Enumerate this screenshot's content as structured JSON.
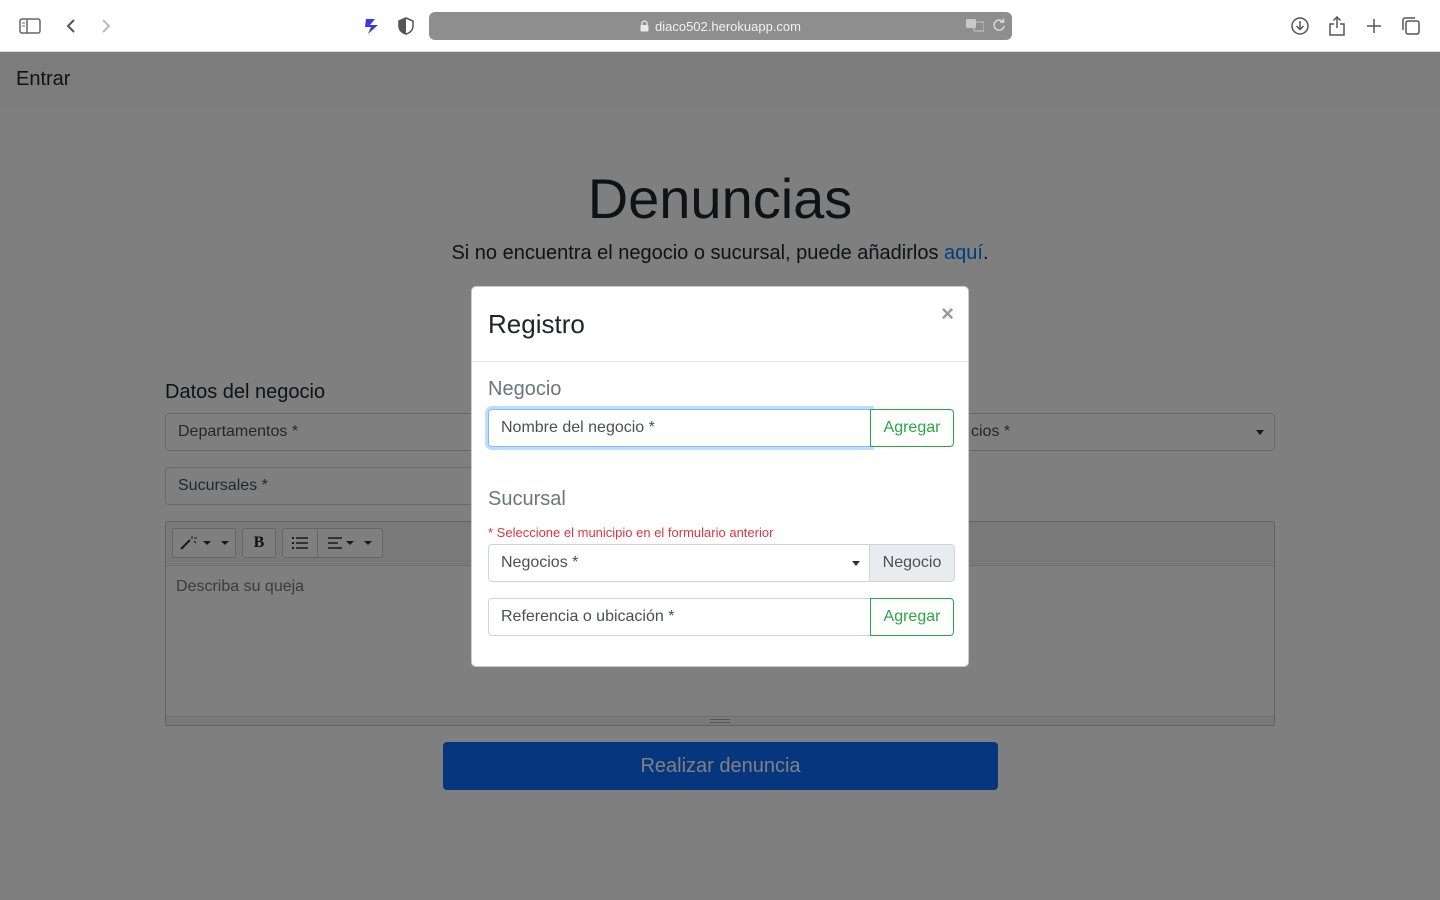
{
  "browser": {
    "url": "diaco502.herokuapp.com",
    "icons": [
      "sidebar-icon",
      "back-icon",
      "forward-icon",
      "extension-icon",
      "shield-icon",
      "lock-icon",
      "translate-icon",
      "reload-icon",
      "download-icon",
      "share-icon",
      "new-tab-icon",
      "tabs-overview-icon"
    ]
  },
  "navbar": {
    "brand": "Entrar"
  },
  "hero": {
    "title": "Denuncias",
    "subtitle_prefix": "Si no encuentra el negocio o sucursal, puede añadirlos ",
    "subtitle_link": "aquí",
    "subtitle_suffix": "."
  },
  "form": {
    "section_label": "Datos del negocio",
    "departamentos": "Departamentos *",
    "negocios_partial": "cios *",
    "sucursales": "Sucursales *",
    "editor_placeholder": "Describa su queja",
    "toolbar": {
      "bold": "B"
    },
    "submit_label": "Realizar denuncia"
  },
  "modal": {
    "title": "Registro",
    "close": "×",
    "negocio_heading": "Negocio",
    "negocio_placeholder": "Nombre del negocio *",
    "negocio_add": "Agregar",
    "sucursal_heading": "Sucursal",
    "warning": "* Seleccione el municipio en el formulario anterior",
    "negocios_select": "Negocios *",
    "negocio_addon": "Negocio",
    "referencia_placeholder": "Referencia o ubicación *",
    "referencia_add": "Agregar"
  },
  "colors": {
    "primary": "#0d6efd",
    "success": "#28a745",
    "danger": "#dc3545",
    "link": "#007bff"
  }
}
